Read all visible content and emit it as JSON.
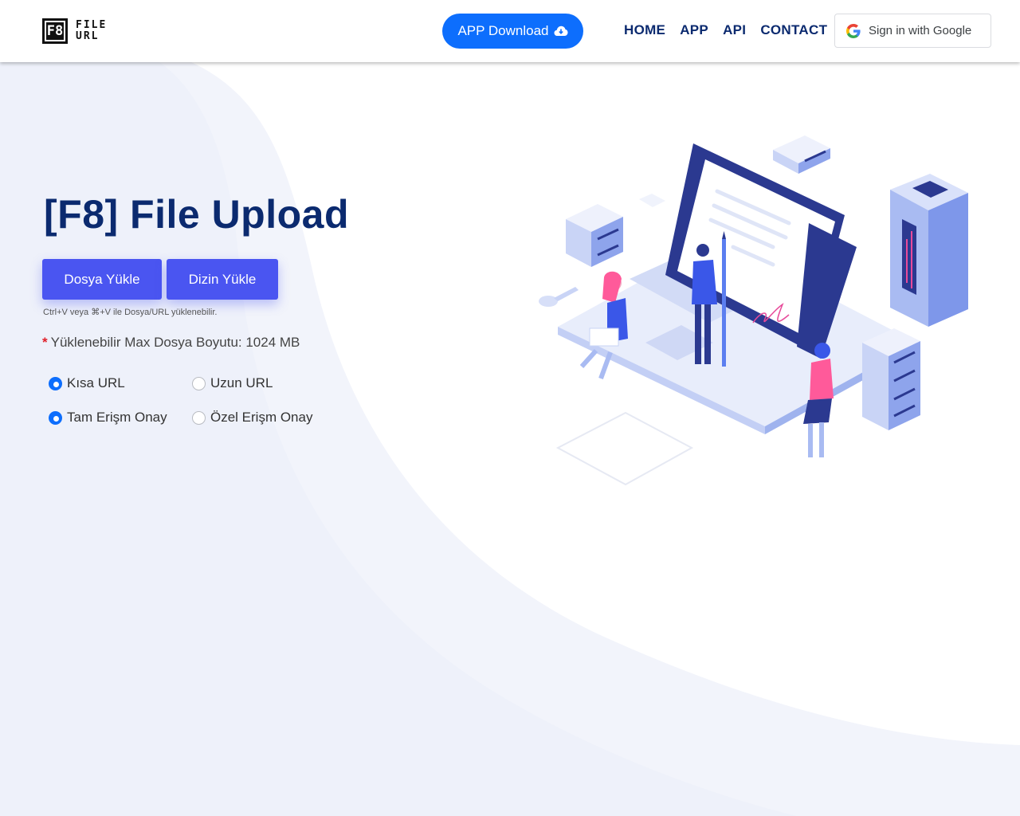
{
  "header": {
    "logo": {
      "box_text": "F8",
      "line1": "FILE",
      "line2": "URL"
    },
    "app_download_label": "APP Download",
    "nav": [
      "HOME",
      "APP",
      "API",
      "CONTACT"
    ],
    "google_signin_label": "Sign in with Google"
  },
  "hero": {
    "title": "[F8] File Upload",
    "upload_file_label": "Dosya Yükle",
    "upload_dir_label": "Dizin Yükle",
    "hint": "Ctrl+V veya ⌘+V ile Dosya/URL yüklenebilir.",
    "max_size_label": "Yüklenebilir Max Dosya Boyutu: 1024 MB"
  },
  "options": {
    "url_type": [
      {
        "label": "Kısa URL",
        "selected": true
      },
      {
        "label": "Uzun URL",
        "selected": false
      }
    ],
    "access": [
      {
        "label": "Tam Erişm Onay",
        "selected": true
      },
      {
        "label": "Özel Erişm Onay",
        "selected": false
      }
    ]
  },
  "colors": {
    "brand_blue": "#0d6efd",
    "primary_button": "#4a55f1",
    "title_navy": "#0b2a6f"
  }
}
